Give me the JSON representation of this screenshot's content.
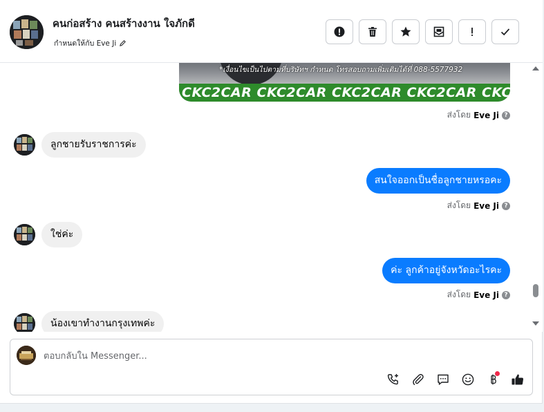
{
  "header": {
    "contact_name": "คนก่อสร้าง คนสร้างงาน ใจภักดี",
    "assigned_to": "กำหนดให้กับ Eve Ji",
    "toolbar": [
      {
        "name": "report-spam-icon"
      },
      {
        "name": "trash-icon"
      },
      {
        "name": "star-icon"
      },
      {
        "name": "mark-unread-icon"
      },
      {
        "name": "priority-icon"
      },
      {
        "name": "done-check-icon"
      }
    ]
  },
  "conversation": {
    "media": {
      "caption": "*เงื่อนไขเป็นไปตามที่บริษัทฯ กำหนด โทรสอบถามเพิ่มเติมได้ที่ 088-5577932",
      "banner": "CKC2CAR CKC2CAR CKC2CAR CKC2CAR CKC2"
    },
    "sent_by_prefix": "ส่งโดย",
    "sent_by_name": "Eve Ji",
    "messages": [
      {
        "direction": "in",
        "text": "ลูกชายรับราชการค่ะ"
      },
      {
        "direction": "out",
        "text": "สนใจออกเป็นชื่อลูกชายหรอคะ"
      },
      {
        "direction": "in",
        "text": "ใช่ค่ะ"
      },
      {
        "direction": "out",
        "text": "ค่ะ ลูกค้าอยู่จังหวัดอะไรคะ"
      },
      {
        "direction": "in",
        "text": "น้องเขาทำงานกรุงเทพค่ะ"
      }
    ]
  },
  "composer": {
    "placeholder": "ตอบกลับใน Messenger...",
    "value": "",
    "actions": [
      "call-icon",
      "attachment-icon",
      "saved-reply-icon",
      "emoji-icon",
      "baht-payment-icon",
      "thumbs-up-icon"
    ]
  },
  "colors": {
    "outgoing_bubble": "#0a7cff",
    "incoming_bubble": "#f0f0f0",
    "banner_green": "#2e8b2b",
    "notification_dot": "#f0284a"
  }
}
